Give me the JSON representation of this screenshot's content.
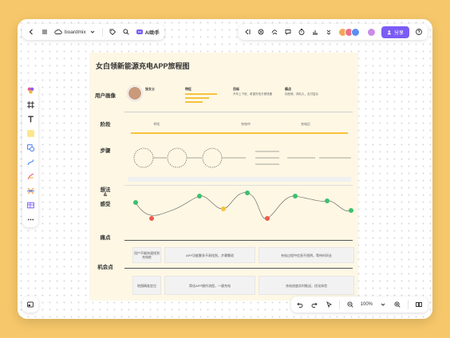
{
  "toolbar": {
    "brand": "boardmix",
    "ai_label": "AI助手",
    "share_label": "分享",
    "zoom": "100%"
  },
  "board": {
    "title": "女白领新能源充电APP旅程图",
    "rows": {
      "persona": "用户画像",
      "stage": "阶段",
      "steps": "步骤",
      "feelings_line1": "想法",
      "feelings_line2": "&",
      "feelings_line3": "感受",
      "pain": "痛点",
      "opportunity": "机会点"
    },
    "persona": {
      "name": "张女士",
      "col2_title": "特征",
      "col3_title": "目标",
      "col4_title": "痛点",
      "col3_text": "开车上下班，希望充电方便快捷",
      "col4_text": "找桩难，排队久，支付复杂"
    },
    "stages": [
      "寻找",
      "充电中",
      "充电后"
    ],
    "pain_boxes": [
      "用户不能快速找到充电桩",
      "APP功能繁多不易找到，步骤繁琐",
      "充电过程中信息不透明，等待时间长"
    ],
    "opportunity_boxes": [
      "地图精准定位",
      "简化APP操作流程，一键充电",
      "充电进度实时推送，优化体验"
    ]
  },
  "colors": {
    "background": "#f7c86b",
    "accent": "#7b5cf5",
    "canvas": "#fdf7e4",
    "stage_bar": "#f5c33b",
    "happy": "#3cc06e",
    "sad": "#ef5a4a"
  }
}
